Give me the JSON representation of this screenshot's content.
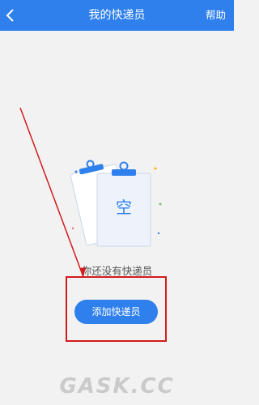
{
  "header": {
    "back_icon": "chevron-left-icon",
    "title": "我的快递员",
    "help_label": "帮助"
  },
  "empty_state": {
    "card_label": "空",
    "message": "你还没有快递员"
  },
  "actions": {
    "add_label": "添加快递员"
  },
  "watermark": {
    "text": "GASK.CC"
  },
  "colors": {
    "accent": "#2f80ed",
    "annotation": "#d11c1c",
    "background": "#f2f2f2"
  }
}
